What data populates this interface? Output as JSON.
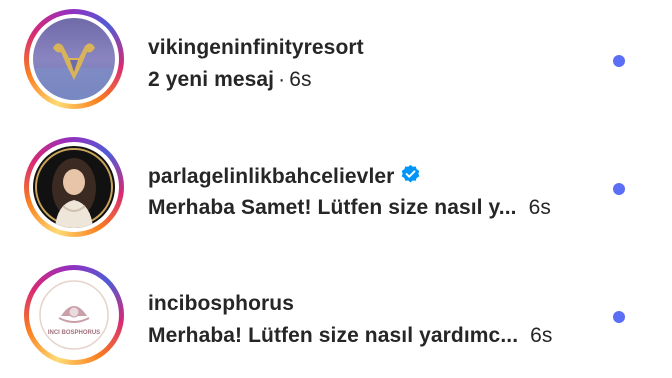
{
  "threads": [
    {
      "username": "vikingeninfinityresort",
      "preview": "2 yeni mesaj",
      "separator": "·",
      "time": "6s",
      "verified": false,
      "unread": true,
      "avatar_icon": "viking-helmet-logo"
    },
    {
      "username": "parlagelinlikbahcelievler",
      "preview": "Merhaba Samet! Lütfen size nasıl y...",
      "time": "6s",
      "verified": true,
      "unread": true,
      "avatar_icon": "bride-portrait"
    },
    {
      "username": "incibosphorus",
      "preview": "Merhaba! Lütfen size nasıl yardımc...",
      "time": "6s",
      "verified": false,
      "unread": true,
      "avatar_icon": "pearl-oyster-logo",
      "avatar_logo_text": "INCI BOSPHORUS"
    }
  ],
  "colors": {
    "unread_dot": "#5b6ef5",
    "verified_badge": "#0095f6",
    "text": "#262626"
  }
}
